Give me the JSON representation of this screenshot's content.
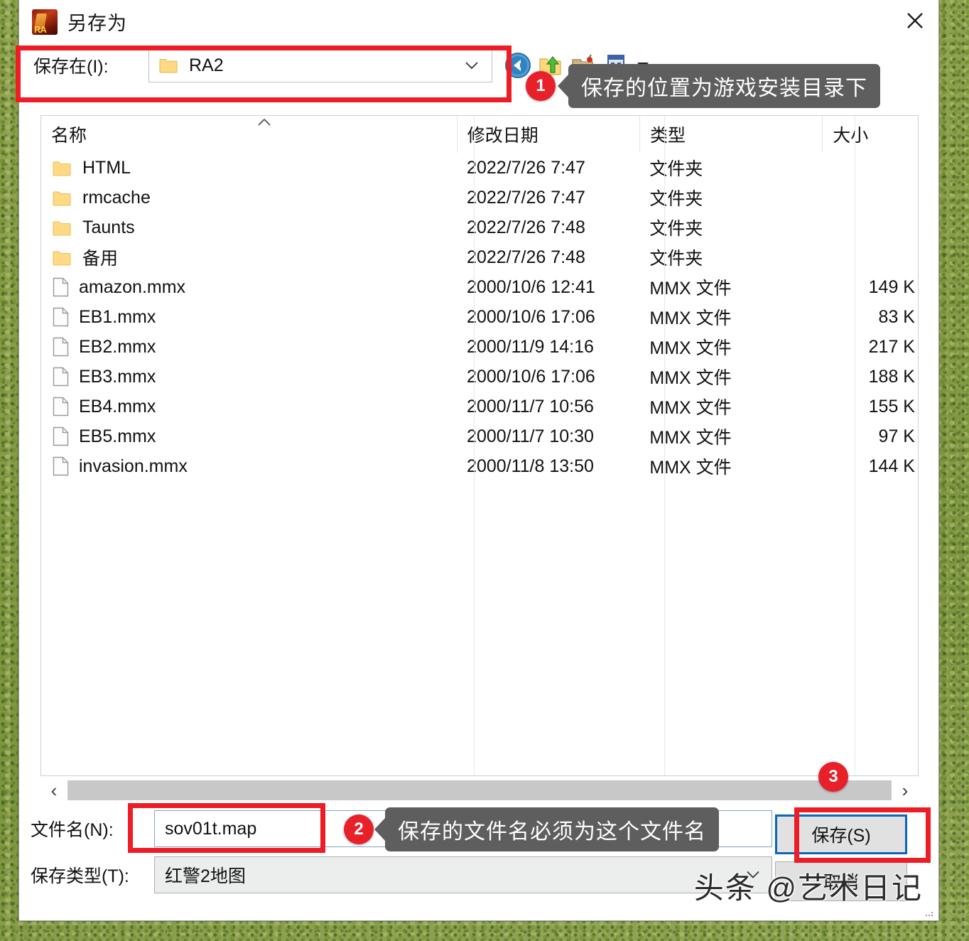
{
  "window": {
    "title": "另存为",
    "icon": "ra2-app-icon",
    "close_label": "×"
  },
  "lookin": {
    "label": "保存在(I):",
    "value": "RA2",
    "folder_icon": "folder-icon",
    "dropdown_icon": "chevron-down-icon"
  },
  "toolbar": {
    "back_icon": "back-arrow-icon",
    "up_icon": "up-one-level-icon",
    "newfolder_icon": "new-folder-icon",
    "views_icon": "views-icon",
    "views_dropdown_icon": "chevron-down-icon"
  },
  "list": {
    "columns": [
      "名称",
      "修改日期",
      "类型",
      "大小"
    ],
    "sort_indicator": "▲",
    "rows": [
      {
        "icon": "folder-icon",
        "name": "HTML",
        "date": "2022/7/26 7:47",
        "type": "文件夹",
        "size": ""
      },
      {
        "icon": "folder-icon",
        "name": "rmcache",
        "date": "2022/7/26 7:47",
        "type": "文件夹",
        "size": ""
      },
      {
        "icon": "folder-icon",
        "name": "Taunts",
        "date": "2022/7/26 7:48",
        "type": "文件夹",
        "size": ""
      },
      {
        "icon": "folder-icon",
        "name": "备用",
        "date": "2022/7/26 7:48",
        "type": "文件夹",
        "size": ""
      },
      {
        "icon": "file-icon",
        "name": "amazon.mmx",
        "date": "2000/10/6 12:41",
        "type": "MMX 文件",
        "size": "149 K"
      },
      {
        "icon": "file-icon",
        "name": "EB1.mmx",
        "date": "2000/10/6 17:06",
        "type": "MMX 文件",
        "size": "83 K"
      },
      {
        "icon": "file-icon",
        "name": "EB2.mmx",
        "date": "2000/11/9 14:16",
        "type": "MMX 文件",
        "size": "217 K"
      },
      {
        "icon": "file-icon",
        "name": "EB3.mmx",
        "date": "2000/10/6 17:06",
        "type": "MMX 文件",
        "size": "188 K"
      },
      {
        "icon": "file-icon",
        "name": "EB4.mmx",
        "date": "2000/11/7 10:56",
        "type": "MMX 文件",
        "size": "155 K"
      },
      {
        "icon": "file-icon",
        "name": "EB5.mmx",
        "date": "2000/11/7 10:30",
        "type": "MMX 文件",
        "size": "97 K"
      },
      {
        "icon": "file-icon",
        "name": "invasion.mmx",
        "date": "2000/11/8 13:50",
        "type": "MMX 文件",
        "size": "144 K"
      }
    ]
  },
  "scrollbar": {
    "left_arrow": "‹",
    "right_arrow": "›"
  },
  "filename": {
    "label": "文件名(N):",
    "value": "sov01t.map"
  },
  "filetype": {
    "label": "保存类型(T):",
    "value": "红警2地图",
    "dropdown_icon": "chevron-down-icon"
  },
  "buttons": {
    "save": "保存(S)",
    "cancel": "取消"
  },
  "annotations": {
    "badges": [
      "1",
      "2",
      "3"
    ],
    "callout_1": "保存的位置为游戏安装目录下",
    "callout_2": "保存的文件名必须为这个文件名",
    "highlight_color": "#ee1c25",
    "badge_color": "#e8202a",
    "callout_bg": "#5e5e5e"
  },
  "watermark": {
    "text": "头条 @艺术日记"
  }
}
